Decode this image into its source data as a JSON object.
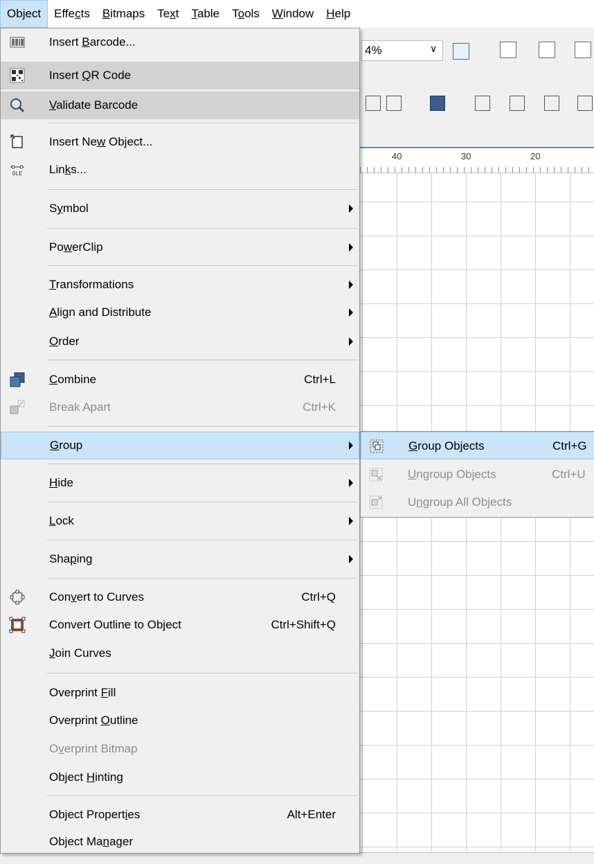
{
  "menubar": {
    "items": [
      {
        "label": "Object",
        "key": "j",
        "active": true
      },
      {
        "label": "Effects",
        "key": "c"
      },
      {
        "label": "Bitmaps",
        "key": "B"
      },
      {
        "label": "Text",
        "key": "x"
      },
      {
        "label": "Table",
        "key": "T"
      },
      {
        "label": "Tools",
        "key": "o"
      },
      {
        "label": "Window",
        "key": "W"
      },
      {
        "label": "Help",
        "key": "H"
      }
    ]
  },
  "toolbar": {
    "zoom_value": "4%"
  },
  "ruler": {
    "labels": [
      "40",
      "30",
      "20"
    ]
  },
  "menu": {
    "items": [
      {
        "pre": "Insert ",
        "key": "B",
        "post": "arcode...",
        "icon": "barcode-icon",
        "shortcut": ""
      },
      {
        "pre": "Insert ",
        "key": "Q",
        "post": "R Code",
        "icon": "qr-code-icon",
        "shortcut": ""
      },
      {
        "pre": "",
        "key": "V",
        "post": "alidate Barcode",
        "icon": "magnifier-icon",
        "shortcut": ""
      },
      {
        "pre": "Insert Ne",
        "key": "w",
        "post": " Object...",
        "icon": "insert-object-icon",
        "shortcut": ""
      },
      {
        "pre": "Lin",
        "key": "k",
        "post": "s...",
        "icon": "ole-link-icon",
        "shortcut": ""
      },
      {
        "pre": "S",
        "key": "y",
        "post": "mbol",
        "shortcut": ""
      },
      {
        "pre": "Po",
        "key": "w",
        "post": "erClip",
        "shortcut": ""
      },
      {
        "pre": "",
        "key": "T",
        "post": "ransformations",
        "shortcut": ""
      },
      {
        "pre": "",
        "key": "A",
        "post": "lign and Distribute",
        "shortcut": ""
      },
      {
        "pre": "",
        "key": "O",
        "post": "rder",
        "shortcut": ""
      },
      {
        "pre": "",
        "key": "C",
        "post": "ombine",
        "icon": "combine-icon",
        "shortcut": "Ctrl+L"
      },
      {
        "pre": "Break Apart",
        "key": "",
        "post": "",
        "icon": "break-apart-icon",
        "shortcut": "Ctrl+K"
      },
      {
        "pre": "",
        "key": "G",
        "post": "roup",
        "shortcut": ""
      },
      {
        "pre": "",
        "key": "H",
        "post": "ide",
        "shortcut": ""
      },
      {
        "pre": "",
        "key": "L",
        "post": "ock",
        "shortcut": ""
      },
      {
        "pre": "Sha",
        "key": "p",
        "post": "ing",
        "shortcut": ""
      },
      {
        "pre": "Con",
        "key": "v",
        "post": "ert to Curves",
        "icon": "convert-curves-icon",
        "shortcut": "Ctrl+Q"
      },
      {
        "pre": "Convert Outline to Ob",
        "key": "j",
        "post": "ect",
        "icon": "convert-outline-icon",
        "shortcut": "Ctrl+Shift+Q"
      },
      {
        "pre": "",
        "key": "J",
        "post": "oin Curves",
        "shortcut": ""
      },
      {
        "pre": "Overprint ",
        "key": "F",
        "post": "ill",
        "shortcut": ""
      },
      {
        "pre": "Overprint ",
        "key": "O",
        "post": "utline",
        "shortcut": ""
      },
      {
        "pre": "O",
        "key": "v",
        "post": "erprint Bitmap",
        "shortcut": ""
      },
      {
        "pre": "Object ",
        "key": "H",
        "post": "inting",
        "shortcut": ""
      },
      {
        "pre": "Object Propert",
        "key": "i",
        "post": "es",
        "shortcut": "Alt+Enter"
      },
      {
        "pre": "Object Ma",
        "key": "n",
        "post": "ager",
        "shortcut": ""
      }
    ]
  },
  "submenu": {
    "items": [
      {
        "pre": "",
        "key": "G",
        "post": "roup Objects",
        "icon": "group-objects-icon",
        "shortcut": "Ctrl+G"
      },
      {
        "pre": "",
        "key": "U",
        "post": "ngroup Objects",
        "icon": "ungroup-objects-icon",
        "shortcut": "Ctrl+U"
      },
      {
        "pre": "U",
        "key": "n",
        "post": "group All Objects",
        "icon": "ungroup-all-icon",
        "shortcut": ""
      }
    ]
  }
}
